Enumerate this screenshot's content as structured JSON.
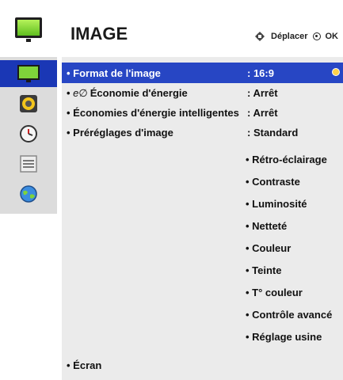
{
  "header": {
    "title": "IMAGE",
    "hint_move": "Déplacer",
    "hint_ok": "OK"
  },
  "sidebar": {
    "items": [
      {
        "name": "tv-icon",
        "active": true
      },
      {
        "name": "speaker-icon",
        "active": false
      },
      {
        "name": "clock-icon",
        "active": false
      },
      {
        "name": "options-icon",
        "active": false
      },
      {
        "name": "globe-network-icon",
        "active": false
      }
    ]
  },
  "menu": {
    "rows": [
      {
        "label": "• Format de l'image",
        "value": ": 16:9"
      },
      {
        "label": "• ",
        "eco": "e∅",
        "label_rest": "Économie d'énergie",
        "value": ": Arrêt"
      },
      {
        "label": "• Économies d'énergie intelligentes",
        "value": ": Arrêt"
      },
      {
        "label": "• Préréglages d'image",
        "value": ": Standard"
      }
    ],
    "sub_items": [
      "• Rétro-éclairage",
      "• Contraste",
      "• Luminosité",
      "• Netteté",
      "• Couleur",
      "• Teinte",
      "• T° couleur",
      "• Contrôle avancé",
      "• Réglage usine"
    ],
    "last_row": "• Écran"
  },
  "colors": {
    "highlight": "#2746c4",
    "sidebar_active": "#1a37b5",
    "menu_bg": "#ebebeb"
  }
}
